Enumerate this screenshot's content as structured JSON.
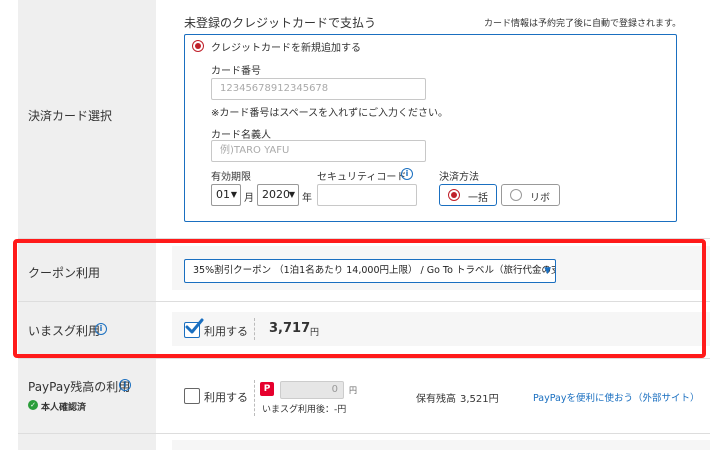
{
  "card_section": {
    "label": "決済カード選択",
    "header": "未登録のクレジットカードで支払う",
    "header_note": "カード情報は予約完了後に自動で登録されます。",
    "new_card_option": "クレジットカードを新規追加する",
    "card_number_label": "カード番号",
    "card_number_placeholder": "1234567891234567​8",
    "card_number_note": "※カード番号はスペースを入れずにご入力ください。",
    "card_holder_label": "カード名義人",
    "card_holder_placeholder": "例)TARO YAFU",
    "expiry_label": "有効期限",
    "expiry_month": "01",
    "month_suffix": "月",
    "expiry_year": "2020",
    "year_suffix": "年",
    "security_label": "セキュリティコード",
    "payment_method_label": "決済方法",
    "payment_lump": "一括",
    "payment_revolving": "リボ"
  },
  "coupon_section": {
    "label": "クーポン利用",
    "selected_coupon": "35%割引クーポン （1泊1名あたり 14,000円上限） / Go To トラベル（旅行代金の支援額）"
  },
  "imasugu_section": {
    "label": "いまスグ利用",
    "checkbox_label": "利用する",
    "amount": "3,717",
    "unit": "円"
  },
  "paypay_section": {
    "label": "PayPay残高の利用",
    "verified_label": "本人確認済",
    "checkbox_label": "利用する",
    "amount_value": "0",
    "unit": "円",
    "after_note": "いまスグ利用後：-円",
    "balance_label": "保有残高",
    "balance_value": "3,521円",
    "link_text": "PayPayを便利に使おう（外部サイト）"
  },
  "colors": {
    "accent_blue": "#1a6fc0",
    "highlight_red": "#ff1a1a",
    "radio_red": "#c0202a",
    "label_bg": "#efefef"
  }
}
